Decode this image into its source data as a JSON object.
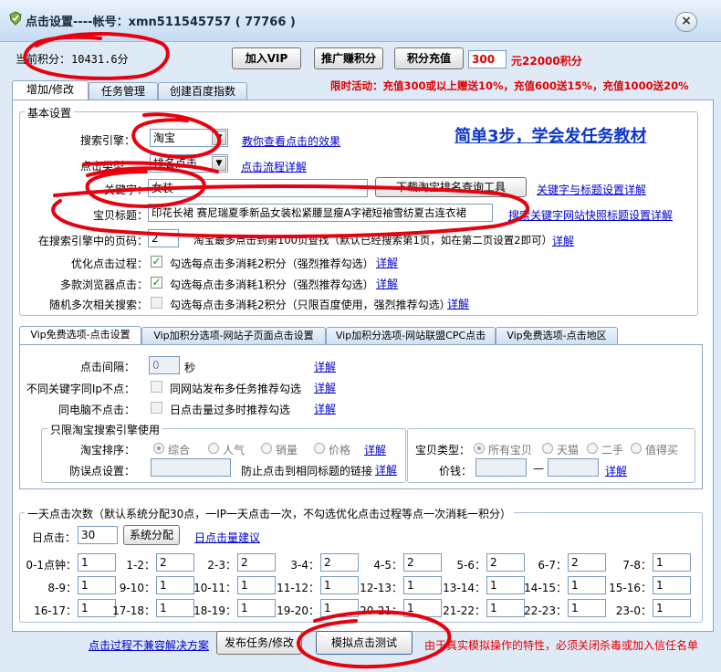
{
  "window": {
    "title": "点击设置----帐号：xmn511545757 ( 77766 )",
    "close_glyph": "×"
  },
  "header": {
    "points_label": "当前积分：",
    "points_value": "10431.6分",
    "vip_button": "加入VIP",
    "promo_button": "推广赚积分",
    "recharge_button": "积分充值",
    "recharge_amount": "300",
    "recharge_text": "元22000积分",
    "promotion": "限时活动：充值300或以上赠送10%，充值600送15%，充值1000送20%"
  },
  "tabs": [
    {
      "label": "增加/修改"
    },
    {
      "label": "任务管理"
    },
    {
      "label": "创建百度指数"
    }
  ],
  "basic": {
    "legend": "基本设置",
    "engine_label": "搜索引擎：",
    "engine_value": "淘宝",
    "engine_link": "教你查看点击的效果",
    "tutorial_link": "简单3步，学会发任务教材",
    "click_type_label": "点击类型：",
    "click_type_value": "排名点击",
    "click_type_link": "点击流程详解",
    "keyword_label": "关键字：",
    "keyword_value": "女装",
    "download_button": "下载淘宝排名查询工具",
    "keyword_link": "关键字与标题设置详解",
    "title_label": "宝贝标题：",
    "title_value": "印花长裙 赛尼瑞夏季新品女装松紧腰显瘦A字裙短袖雪纺夏古连衣裙",
    "title_link": "搜索关键字网站快照标题设置详解",
    "page_label": "在搜索引擎中的页码：",
    "page_value": "2",
    "page_hint": "淘宝最多点击到第100页查找（默认已经搜索第1页，如在第二页设置2即可）",
    "page_link": "详解",
    "opt1_label": "优化点击过程：",
    "opt1_text": "勾选每点击多消耗2积分（强烈推荐勾选）",
    "opt1_link": "详解",
    "opt2_label": "多款浏览器点击：",
    "opt2_text": "勾选每点击多消耗1积分（强烈推荐勾选）",
    "opt2_link": "详解",
    "opt3_label": "随机多次相关搜索：",
    "opt3_text": "勾选每点击多消耗2积分（只限百度使用，强烈推荐勾选）",
    "opt3_link": "详解",
    "check_glyph": "✓"
  },
  "vip_tabs": [
    {
      "label": "Vip免费选项-点击设置"
    },
    {
      "label": "Vip加积分选项-网站子页面点击设置"
    },
    {
      "label": "Vip加积分选项-网站联盟CPC点击"
    },
    {
      "label": "Vip免费选项-点击地区"
    }
  ],
  "vip": {
    "interval_label": "点击间隔：",
    "interval_value": "0",
    "interval_unit": "秒",
    "interval_link": "详解",
    "ip_label": "不同关键字同Ip不点：",
    "ip_text": "同网站发布多任务推荐勾选",
    "ip_link": "详解",
    "pc_label": "同电脑不点击：",
    "pc_text": "日点击量过多时推荐勾选",
    "pc_link": "详解",
    "taobao_legend": "只限淘宝搜索引擎使用",
    "sort_label": "淘宝排序：",
    "sort_options": [
      "综合",
      "人气",
      "销量",
      "价格"
    ],
    "sort_link": "详解",
    "misclick_label": "防误点设置：",
    "misclick_text": "防止点击到相同标题的链接",
    "misclick_link": "详解",
    "type_label": "宝贝类型：",
    "type_options": [
      "所有宝贝",
      "天猫",
      "二手",
      "值得买"
    ],
    "price_label": "价钱：",
    "price_sep": "—",
    "price_link": "详解"
  },
  "daily": {
    "legend": "一天点击次数（默认系统分配30点，一IP一天点击一次，不勾选优化点击过程等点一次消耗一积分）",
    "clicks_label": "日点击：",
    "clicks_value": "30",
    "allocate_button": "系统分配",
    "suggest_link": "日点击量建议",
    "hours": [
      {
        "label": "0-1点钟：",
        "value": "1"
      },
      {
        "label": "1-2：",
        "value": "2"
      },
      {
        "label": "2-3：",
        "value": "2"
      },
      {
        "label": "3-4：",
        "value": "2"
      },
      {
        "label": "4-5：",
        "value": "2"
      },
      {
        "label": "5-6：",
        "value": "2"
      },
      {
        "label": "6-7：",
        "value": "2"
      },
      {
        "label": "7-8：",
        "value": "1"
      },
      {
        "label": "8-9：",
        "value": "1"
      },
      {
        "label": "9-10：",
        "value": "1"
      },
      {
        "label": "10-11：",
        "value": "1"
      },
      {
        "label": "11-12：",
        "value": "1"
      },
      {
        "label": "12-13：",
        "value": "1"
      },
      {
        "label": "13-14：",
        "value": "1"
      },
      {
        "label": "14-15：",
        "value": "1"
      },
      {
        "label": "15-16：",
        "value": "1"
      },
      {
        "label": "16-17：",
        "value": "1"
      },
      {
        "label": "17-18：",
        "value": "1"
      },
      {
        "label": "18-19：",
        "value": "1"
      },
      {
        "label": "19-20：",
        "value": "1"
      },
      {
        "label": "20-21：",
        "value": "1"
      },
      {
        "label": "21-22：",
        "value": "1"
      },
      {
        "label": "22-23：",
        "value": "1"
      },
      {
        "label": "23-0：",
        "value": "1"
      }
    ]
  },
  "footer": {
    "solution_link": "点击过程不兼容解决方案",
    "publish_button": "发布任务/修改",
    "test_button": "模拟点击测试",
    "note": "由于真实模拟操作的特性，必须关闭杀毒或加入信任名单"
  },
  "colors": {
    "annotation": "#e8000f",
    "link": "#0000cc",
    "warning": "#e00000"
  }
}
